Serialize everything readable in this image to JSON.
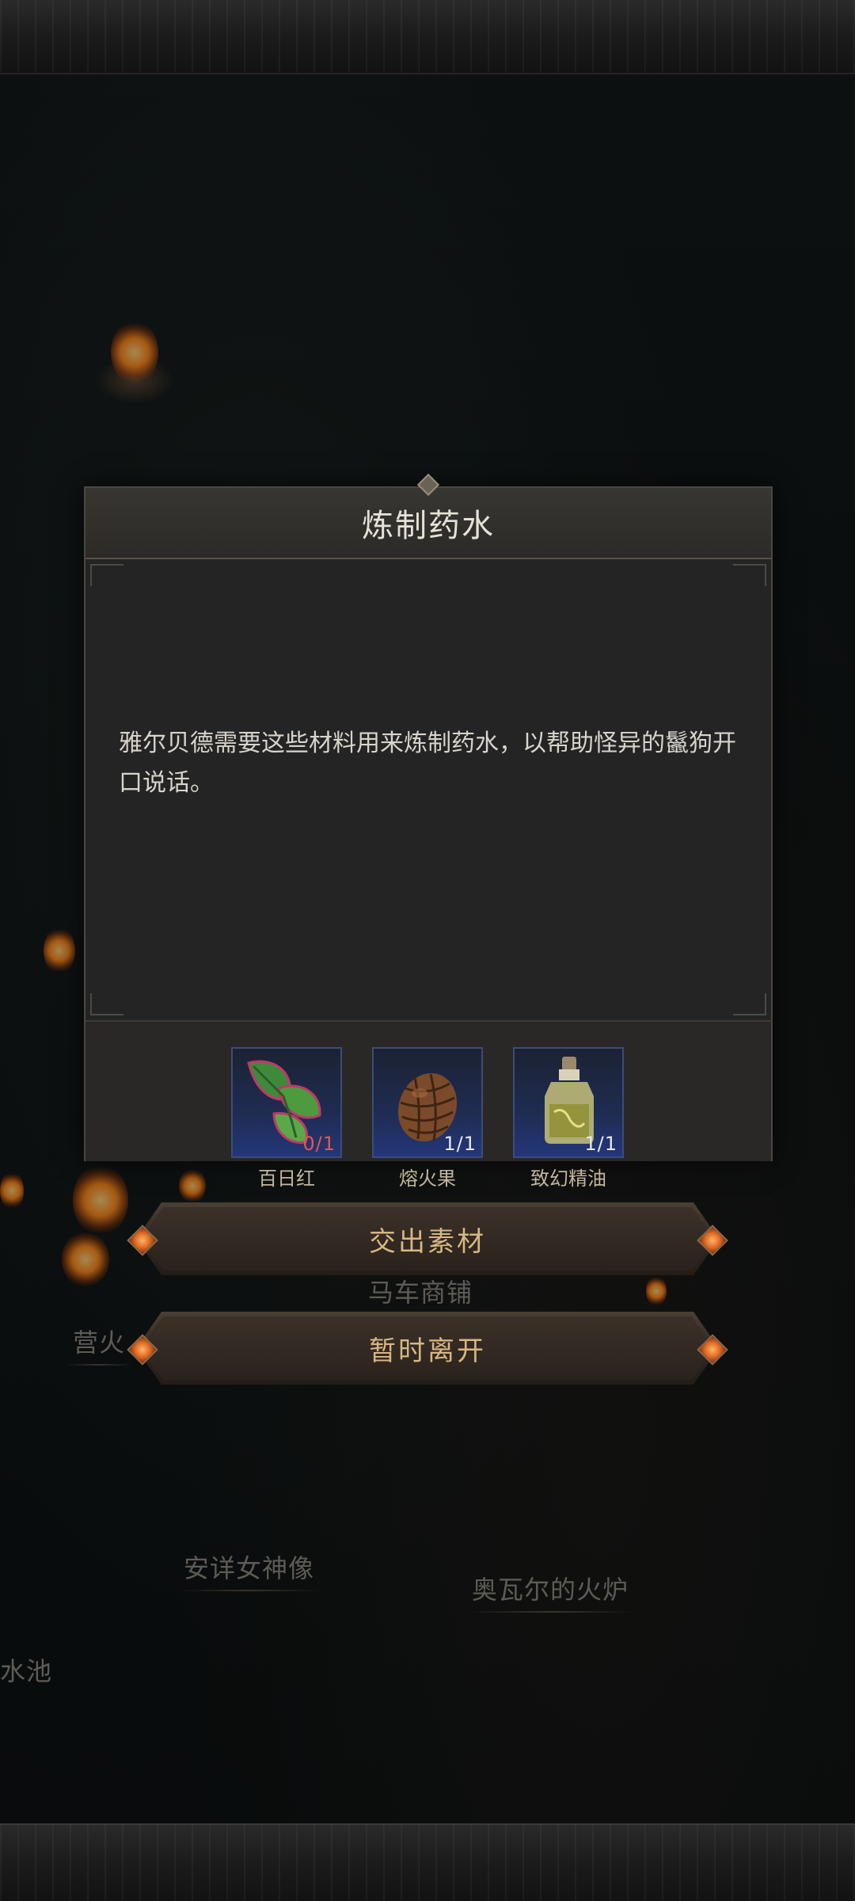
{
  "dialog": {
    "title": "炼制药水",
    "description": "雅尔贝德需要这些材料用来炼制药水，以帮助怪异的鬣狗开口说话。",
    "items": [
      {
        "name": "百日红",
        "count": "0/1",
        "icon": "red-green-leaf-icon"
      },
      {
        "name": "熔火果",
        "count": "1/1",
        "icon": "pinecone-fruit-icon"
      },
      {
        "name": "致幻精油",
        "count": "1/1",
        "icon": "oil-bottle-icon"
      }
    ]
  },
  "buttons": {
    "submit": "交出素材",
    "leave": "暂时离开"
  },
  "map_labels": {
    "carriage_shop": "马车商铺",
    "campfire": "营火",
    "goddess_statue": "安详女神像",
    "forge": "奥瓦尔的火炉",
    "pool": "水池"
  },
  "colors": {
    "button_text": "#d7b782",
    "lacking_count": "#e15a4a",
    "slot_blue": "#24367a"
  }
}
